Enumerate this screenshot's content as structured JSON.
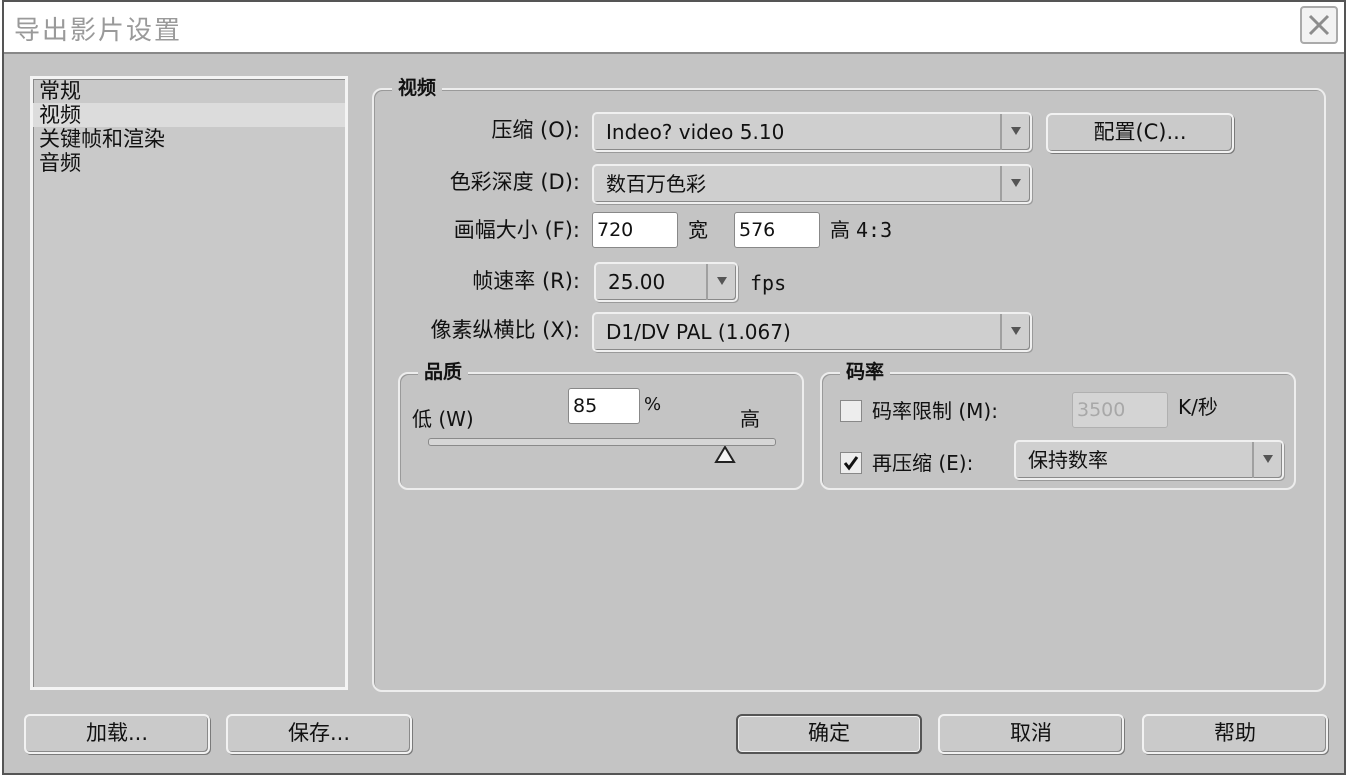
{
  "window": {
    "title": "导出影片设置"
  },
  "nav": {
    "items": [
      {
        "label": "常规"
      },
      {
        "label": "视频"
      },
      {
        "label": "关键帧和渲染"
      },
      {
        "label": "音频"
      }
    ],
    "selected": "视频"
  },
  "video": {
    "group_label": "视频",
    "compression": {
      "label": "压缩 (O):",
      "value": "Indeo? video 5.10",
      "config_button": "配置(C)..."
    },
    "color_depth": {
      "label": "色彩深度 (D):",
      "value": "数百万色彩"
    },
    "frame_size": {
      "label": "画幅大小 (F):",
      "width": "720",
      "width_unit": "宽",
      "height": "576",
      "height_unit": "高",
      "aspect": "4:3"
    },
    "frame_rate": {
      "label": "帧速率 (R):",
      "value": "25.00",
      "unit": "fps"
    },
    "pixel_aspect": {
      "label": "像素纵横比 (X):",
      "value": "D1/DV PAL (1.067)"
    }
  },
  "quality": {
    "group_label": "品质",
    "low_label": "低 (W)",
    "high_label": "高",
    "value": "85",
    "unit": "%",
    "level": 0.85
  },
  "bitrate": {
    "group_label": "码率",
    "limit": {
      "label": "码率限制 (M):",
      "checked": false,
      "value": "3500",
      "unit": "K/秒"
    },
    "recompress": {
      "label": "再压缩 (E):",
      "checked": true,
      "value": "保持数率"
    }
  },
  "buttons": {
    "load": "加载...",
    "save": "保存...",
    "ok": "确定",
    "cancel": "取消",
    "help": "帮助"
  },
  "icons": [
    "close-icon",
    "dropdown-arrow-icon",
    "checkmark-icon",
    "slider-thumb-icon"
  ]
}
